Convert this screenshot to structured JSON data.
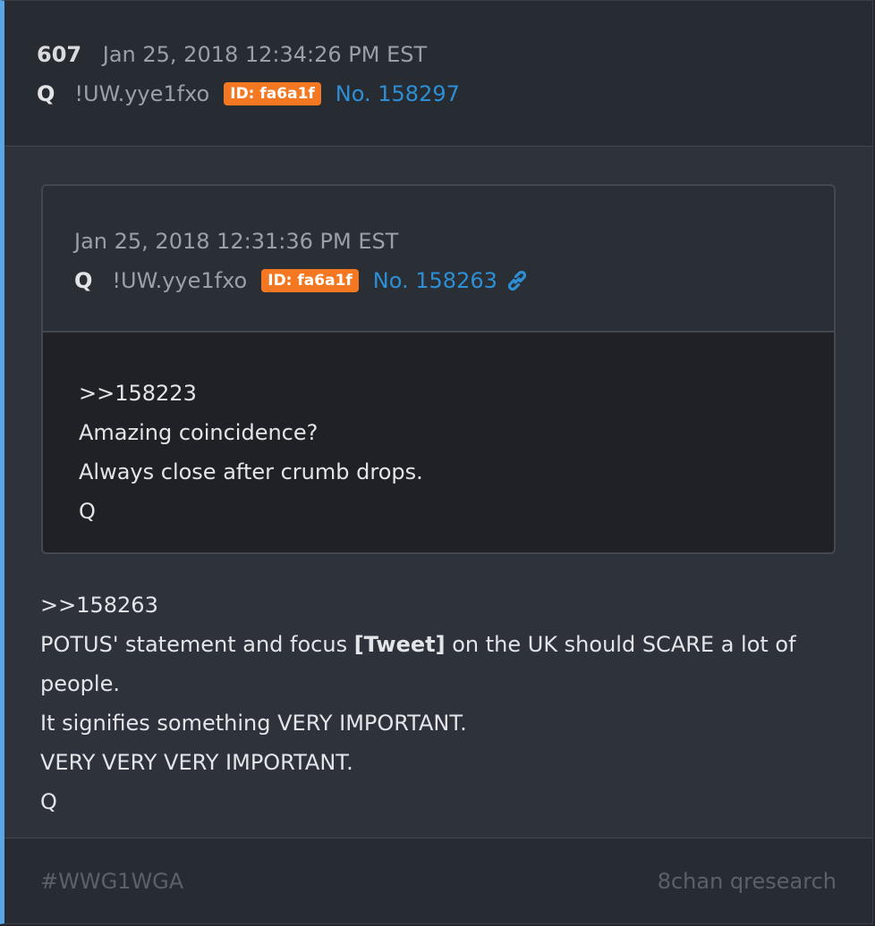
{
  "header": {
    "post_number": "607",
    "date": "Jan 25, 2018 12:34:26 PM EST",
    "author": "Q",
    "tripcode": "!UW.yye1fxo",
    "id_badge": "ID: fa6a1f",
    "post_no": "No. 158297"
  },
  "quoted_post": {
    "date": "Jan 25, 2018 12:31:36 PM EST",
    "author": "Q",
    "tripcode": "!UW.yye1fxo",
    "id_badge": "ID: fa6a1f",
    "post_no": "No. 158263",
    "link_icon": "link-icon",
    "lines": [
      ">>158223",
      "Amazing coincidence?",
      "Always close after crumb drops.",
      "Q"
    ]
  },
  "body": {
    "reply_ref": ">>158263",
    "text_before": "POTUS' statement and focus ",
    "tweet_label": "[Tweet]",
    "text_after": " on the UK should SCARE a lot of people.",
    "line3": "It signifies something VERY IMPORTANT.",
    "line4": "VERY VERY VERY IMPORTANT.",
    "signature": "Q"
  },
  "footer": {
    "hashtag": "#WWG1WGA",
    "source": "8chan qresearch"
  },
  "colors": {
    "accent": "#5aa7e8",
    "id_badge": "#f47822",
    "link": "#2d8fd5"
  }
}
